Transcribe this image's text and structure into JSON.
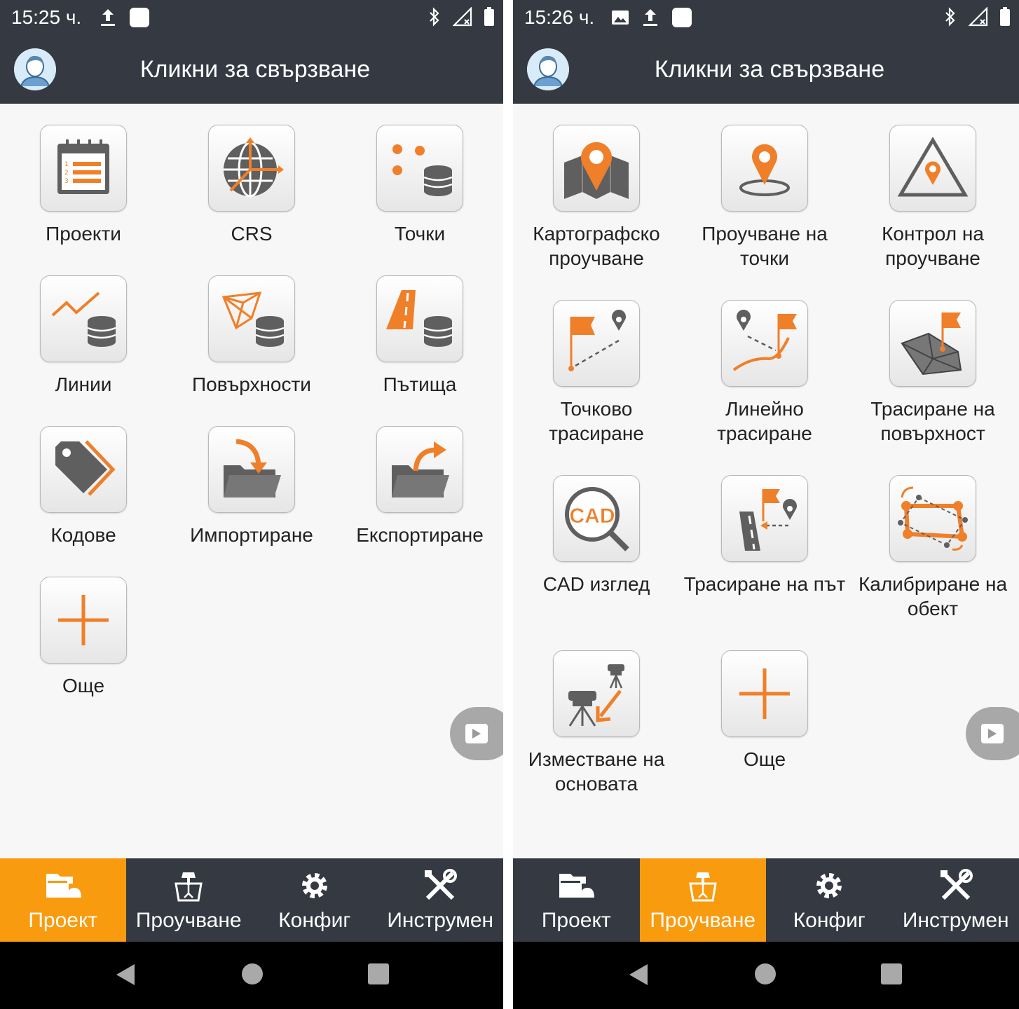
{
  "left": {
    "status_time": "15:25 ч.",
    "title": "Кликни за свързване",
    "tiles": [
      {
        "label": "Проекти",
        "icon": "calendar-list-icon"
      },
      {
        "label": "CRS",
        "icon": "globe-axes-icon"
      },
      {
        "label": "Точки",
        "icon": "points-database-icon"
      },
      {
        "label": "Линии",
        "icon": "line-database-icon"
      },
      {
        "label": "Повърхности",
        "icon": "surface-database-icon"
      },
      {
        "label": "Пътища",
        "icon": "road-database-icon"
      },
      {
        "label": "Кодове",
        "icon": "tag-icon"
      },
      {
        "label": "Импортиране",
        "icon": "import-folder-icon"
      },
      {
        "label": "Експортиране",
        "icon": "export-folder-icon"
      },
      {
        "label": "Още",
        "icon": "plus-icon"
      }
    ],
    "nav": [
      {
        "label": "Проект",
        "icon": "folder-icon"
      },
      {
        "label": "Проучване",
        "icon": "survey-icon"
      },
      {
        "label": "Конфиг",
        "icon": "gear-icon"
      },
      {
        "label": "Инструмен",
        "icon": "tools-icon"
      }
    ],
    "active_nav": "Проект"
  },
  "right": {
    "status_time": "15:26 ч.",
    "title": "Кликни за свързване",
    "tiles": [
      {
        "label": "Картографско проучване",
        "icon": "map-pin-icon"
      },
      {
        "label": "Проучване на точки",
        "icon": "point-survey-icon"
      },
      {
        "label": "Контрол на проучване",
        "icon": "control-triangle-icon"
      },
      {
        "label": "Точково трасиране",
        "icon": "point-stakeout-icon"
      },
      {
        "label": "Линейно трасиране",
        "icon": "line-stakeout-icon"
      },
      {
        "label": "Трасиране на повърхност",
        "icon": "surface-stakeout-icon"
      },
      {
        "label": "CAD изглед",
        "icon": "cad-magnifier-icon"
      },
      {
        "label": "Трасиране на път",
        "icon": "road-stakeout-icon"
      },
      {
        "label": "Калибриране на обект",
        "icon": "calibration-icon"
      },
      {
        "label": "Изместване на основата",
        "icon": "base-shift-icon"
      },
      {
        "label": "Още",
        "icon": "plus-icon"
      }
    ],
    "nav": [
      {
        "label": "Проект",
        "icon": "folder-icon"
      },
      {
        "label": "Проучване",
        "icon": "survey-icon"
      },
      {
        "label": "Конфиг",
        "icon": "gear-icon"
      },
      {
        "label": "Инструмен",
        "icon": "tools-icon"
      }
    ],
    "active_nav": "Проучване"
  },
  "colors": {
    "accent": "#f07f2a",
    "nav_active": "#f99b0f",
    "bar_bg": "#353a42",
    "icon_gray": "#5f5f5f"
  }
}
